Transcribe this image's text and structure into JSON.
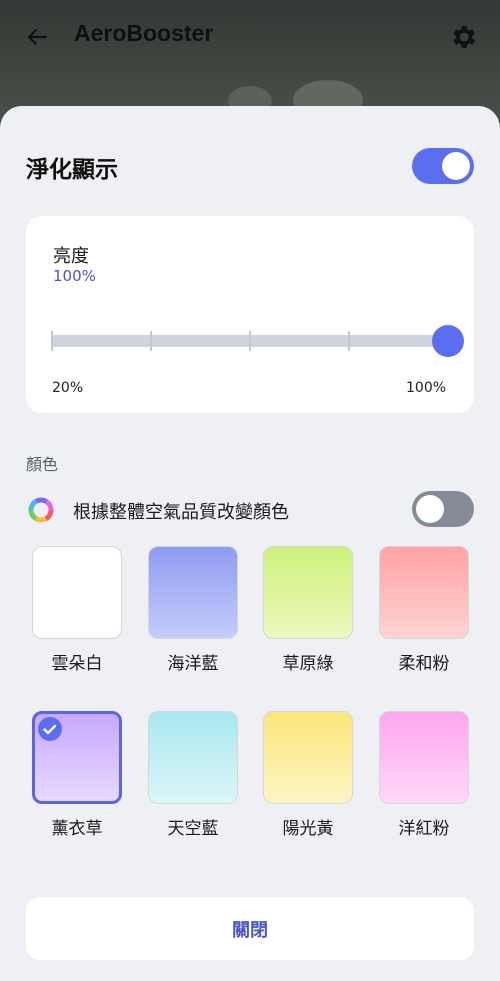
{
  "appbar": {
    "title": "AeroBooster"
  },
  "sheet": {
    "title": "淨化顯示",
    "display_toggle_on": true,
    "brightness": {
      "label": "亮度",
      "value_text": "100%",
      "value_percent": 100,
      "min_label": "20%",
      "max_label": "100%"
    },
    "color_section": {
      "label": "顏色",
      "adaptive_label": "根據整體空氣品質改變顏色",
      "adaptive_toggle_on": false,
      "swatches": [
        {
          "label": "雲朵白",
          "top": "#ffffff",
          "bottom": "#ffffff",
          "selected": false
        },
        {
          "label": "海洋藍",
          "top": "#8f9bf2",
          "bottom": "#c5cdfa",
          "selected": false
        },
        {
          "label": "草原綠",
          "top": "#cdf07a",
          "bottom": "#edfac0",
          "selected": false
        },
        {
          "label": "柔和粉",
          "top": "#ffa3a3",
          "bottom": "#ffd3d3",
          "selected": false
        },
        {
          "label": "薰衣草",
          "top": "#c7a8ff",
          "bottom": "#e6d9ff",
          "selected": true
        },
        {
          "label": "天空藍",
          "top": "#a8e8ef",
          "bottom": "#dcf6f8",
          "selected": false
        },
        {
          "label": "陽光黃",
          "top": "#fbe77a",
          "bottom": "#fdf5c4",
          "selected": false
        },
        {
          "label": "洋紅粉",
          "top": "#ffa6ef",
          "bottom": "#ffd8f8",
          "selected": false
        }
      ]
    },
    "close_label": "關閉"
  },
  "colors": {
    "accent": "#5b6ef0",
    "sheet_bg": "#eef0f4"
  }
}
